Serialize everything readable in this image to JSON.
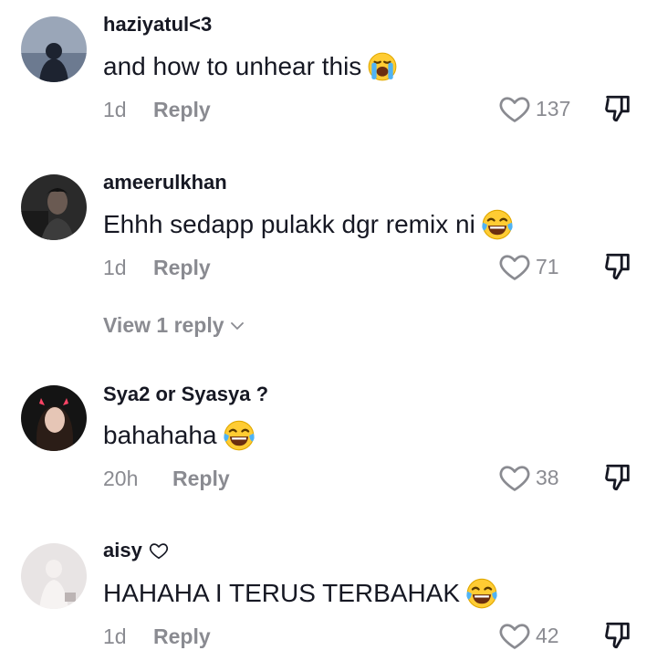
{
  "comments": [
    {
      "username": "haziyatul<3",
      "text": "and how to unhear this",
      "emoji": "loudly-crying-face",
      "time": "1d",
      "reply_label": "Reply",
      "likes": "137"
    },
    {
      "username": "ameerulkhan",
      "text": "Ehhh sedapp pulakk dgr remix ni",
      "emoji": "face-with-tears-of-joy",
      "time": "1d",
      "reply_label": "Reply",
      "likes": "71",
      "view_replies": "View 1 reply"
    },
    {
      "username": "Sya2 or Syasya ?",
      "text": "bahahaha",
      "emoji": "face-with-tears-of-joy",
      "time": "20h",
      "reply_label": "Reply",
      "likes": "38"
    },
    {
      "username": "aisy",
      "username_icon": "heart-outline",
      "text": "HAHAHA I TERUS TERBAHAK",
      "emoji": "face-with-tears-of-joy",
      "time": "1d",
      "reply_label": "Reply",
      "likes": "42"
    }
  ],
  "colors": {
    "primary_text": "#161823",
    "secondary_text": "#8a8b91",
    "background": "#ffffff"
  }
}
